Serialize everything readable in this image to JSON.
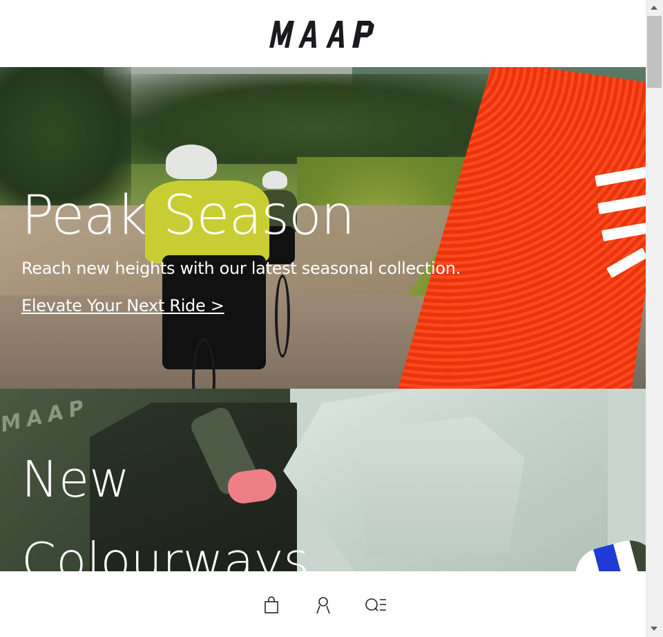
{
  "header": {
    "logo_text": "MAAP"
  },
  "hero_primary": {
    "title": "Peak Season",
    "subtitle": "Reach new heights with our latest seasonal collection.",
    "link_label": "Elevate Your Next Ride >",
    "accent_color": "#e8340e"
  },
  "hero_secondary": {
    "title_line1": "New",
    "title_line2": "Colourways",
    "garment_mark": "MAAP"
  },
  "bottom_nav": {
    "icons": [
      "shopping-bag-icon",
      "account-icon",
      "search-menu-icon"
    ]
  }
}
